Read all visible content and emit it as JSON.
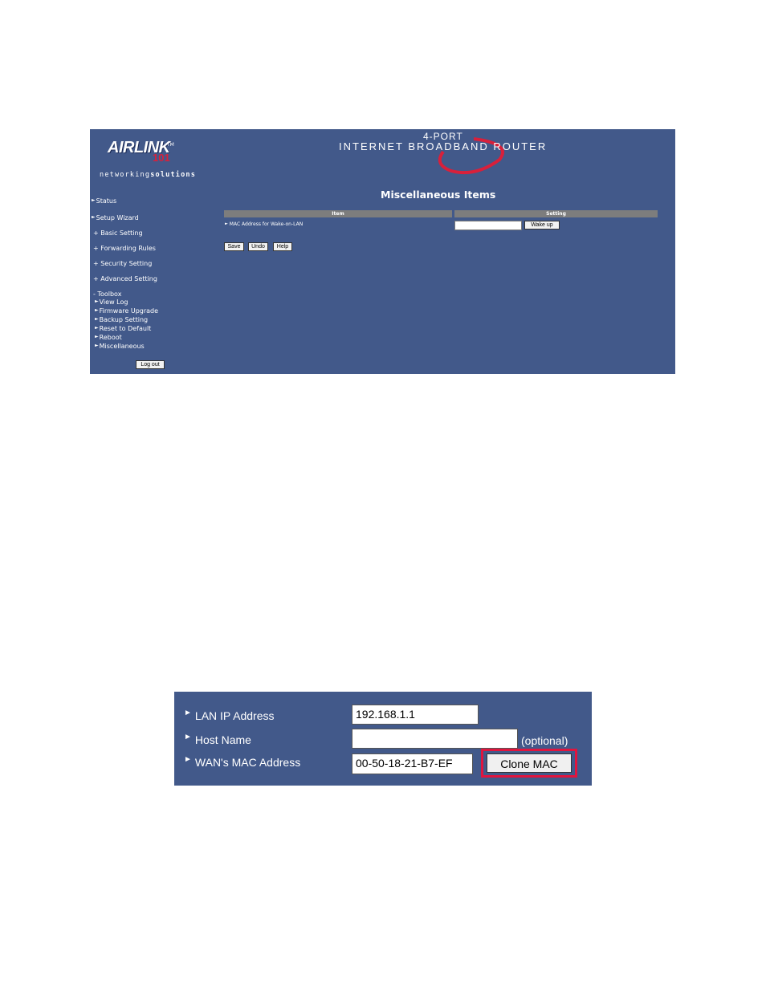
{
  "router_page": {
    "logo": {
      "word": "AIRLINK",
      "number": "101",
      "tm": "TM",
      "tagline_light": "networking",
      "tagline_bold": "solutions"
    },
    "banner": {
      "port": "4-PORT",
      "title": "INTERNET BROADBAND ROUTER"
    },
    "menu": {
      "status": "Status",
      "setup_wizard": "Setup Wizard",
      "basic_setting": "+ Basic Setting",
      "forwarding_rules": "+ Forwarding Rules",
      "security_setting": "+ Security Setting",
      "advanced_setting": "+ Advanced Setting",
      "toolbox": "- Toolbox",
      "toolbox_items": [
        "View Log",
        "Firmware Upgrade",
        "Backup Setting",
        "Reset to Default",
        "Reboot",
        "Miscellaneous"
      ],
      "logout": "Log out"
    },
    "title": "Miscellaneous Items",
    "table": {
      "col_item": "Item",
      "col_setting": "Setting",
      "row_label": "MAC Address for Wake-on-LAN",
      "row_value": "",
      "row_button": "Wake up"
    },
    "buttons": {
      "save": "Save",
      "undo": "Undo",
      "help": "Help"
    }
  },
  "wan_panel": {
    "lan_ip_label": "LAN IP Address",
    "lan_ip_value": "192.168.1.1",
    "host_name_label": "Host Name",
    "host_name_value": "",
    "optional": "(optional)",
    "wan_mac_label": "WAN's MAC Address",
    "wan_mac_value": "00-50-18-21-B7-EF",
    "clone_button": "Clone MAC"
  },
  "colors": {
    "panel": "#42598a",
    "highlight": "#e0153e",
    "logo_red": "#d8203b"
  }
}
